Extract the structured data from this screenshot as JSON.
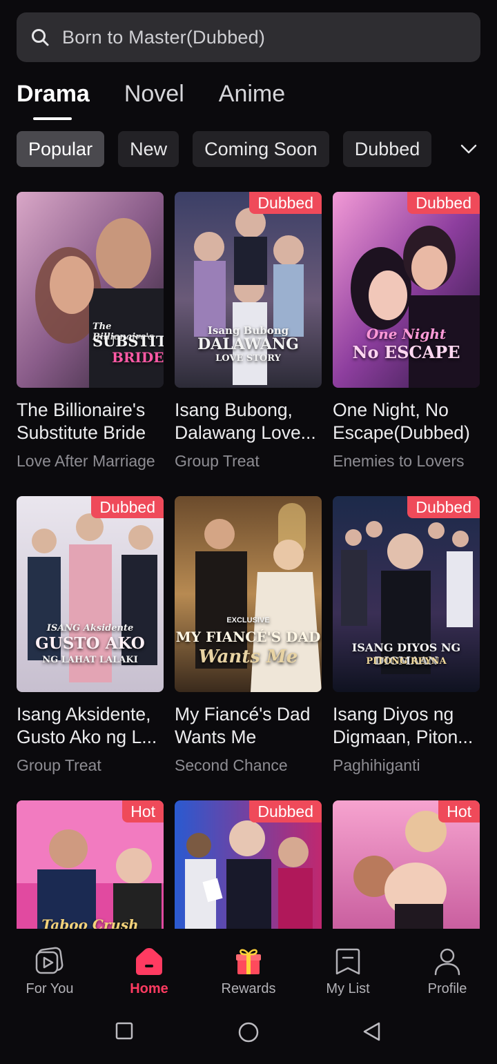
{
  "search": {
    "placeholder": "Born to Master(Dubbed)",
    "icon": "search-icon"
  },
  "tabs": [
    {
      "label": "Drama",
      "active": true
    },
    {
      "label": "Novel",
      "active": false
    },
    {
      "label": "Anime",
      "active": false
    }
  ],
  "chips": [
    {
      "label": "Popular",
      "active": true
    },
    {
      "label": "New",
      "active": false
    },
    {
      "label": "Coming Soon",
      "active": false
    },
    {
      "label": "Dubbed",
      "active": false
    }
  ],
  "cards": [
    {
      "title_line1": "The Billionaire's",
      "title_line2": "Substitute Bride",
      "genre": "Love After Marriage",
      "badge": "",
      "poster_text": [
        "The Billionaire's",
        "SUBSTITUTE",
        "BRIDE"
      ]
    },
    {
      "title_line1": "Isang Bubong,",
      "title_line2": "Dalawang Love...",
      "genre": "Group Treat",
      "badge": "Dubbed",
      "poster_text": [
        "Isang Bubong",
        "DALAWANG",
        "LOVE STORY"
      ]
    },
    {
      "title_line1": "One Night, No",
      "title_line2": "Escape(Dubbed)",
      "genre": "Enemies to Lovers",
      "badge": "Dubbed",
      "poster_text": [
        "One Night",
        "No ESCAPE",
        ""
      ]
    },
    {
      "title_line1": "Isang Aksidente,",
      "title_line2": "Gusto Ako ng L...",
      "genre": "Group Treat",
      "badge": "Dubbed",
      "poster_text": [
        "ISANG Aksidente",
        "GUSTO AKO",
        "NG LAHAT LALAKI"
      ]
    },
    {
      "title_line1": "My Fiancé's Dad",
      "title_line2": "Wants Me",
      "genre": "Second Chance",
      "badge": "",
      "poster_text": [
        "EXCLUSIVE",
        "MY FIANCÉ'S DAD",
        "Wants Me"
      ]
    },
    {
      "title_line1": "Isang Diyos ng",
      "title_line2": "Digmaan, Piton...",
      "genre": "Paghihiganti",
      "badge": "Dubbed",
      "poster_text": [
        "ISANG DIYOS NG DIGMAAN",
        "PITONG REYNA",
        ""
      ]
    },
    {
      "title_line1": "",
      "title_line2": "",
      "genre": "",
      "badge": "Hot",
      "poster_text": [
        "Taboo Crush",
        "",
        ""
      ]
    },
    {
      "title_line1": "",
      "title_line2": "",
      "genre": "",
      "badge": "Dubbed",
      "poster_text": [
        "",
        "",
        ""
      ]
    },
    {
      "title_line1": "",
      "title_line2": "",
      "genre": "",
      "badge": "Hot",
      "poster_text": [
        "",
        "",
        ""
      ]
    }
  ],
  "nav": [
    {
      "label": "For You",
      "icon": "play-square-icon",
      "active": false
    },
    {
      "label": "Home",
      "icon": "home-icon",
      "active": true
    },
    {
      "label": "Rewards",
      "icon": "gift-icon",
      "active": false
    },
    {
      "label": "My List",
      "icon": "bookmark-list-icon",
      "active": false
    },
    {
      "label": "Profile",
      "icon": "profile-icon",
      "active": false
    }
  ],
  "colors": {
    "accent": "#ff3b61",
    "badge": "#ef4a5a",
    "background": "#0b0a0d"
  }
}
